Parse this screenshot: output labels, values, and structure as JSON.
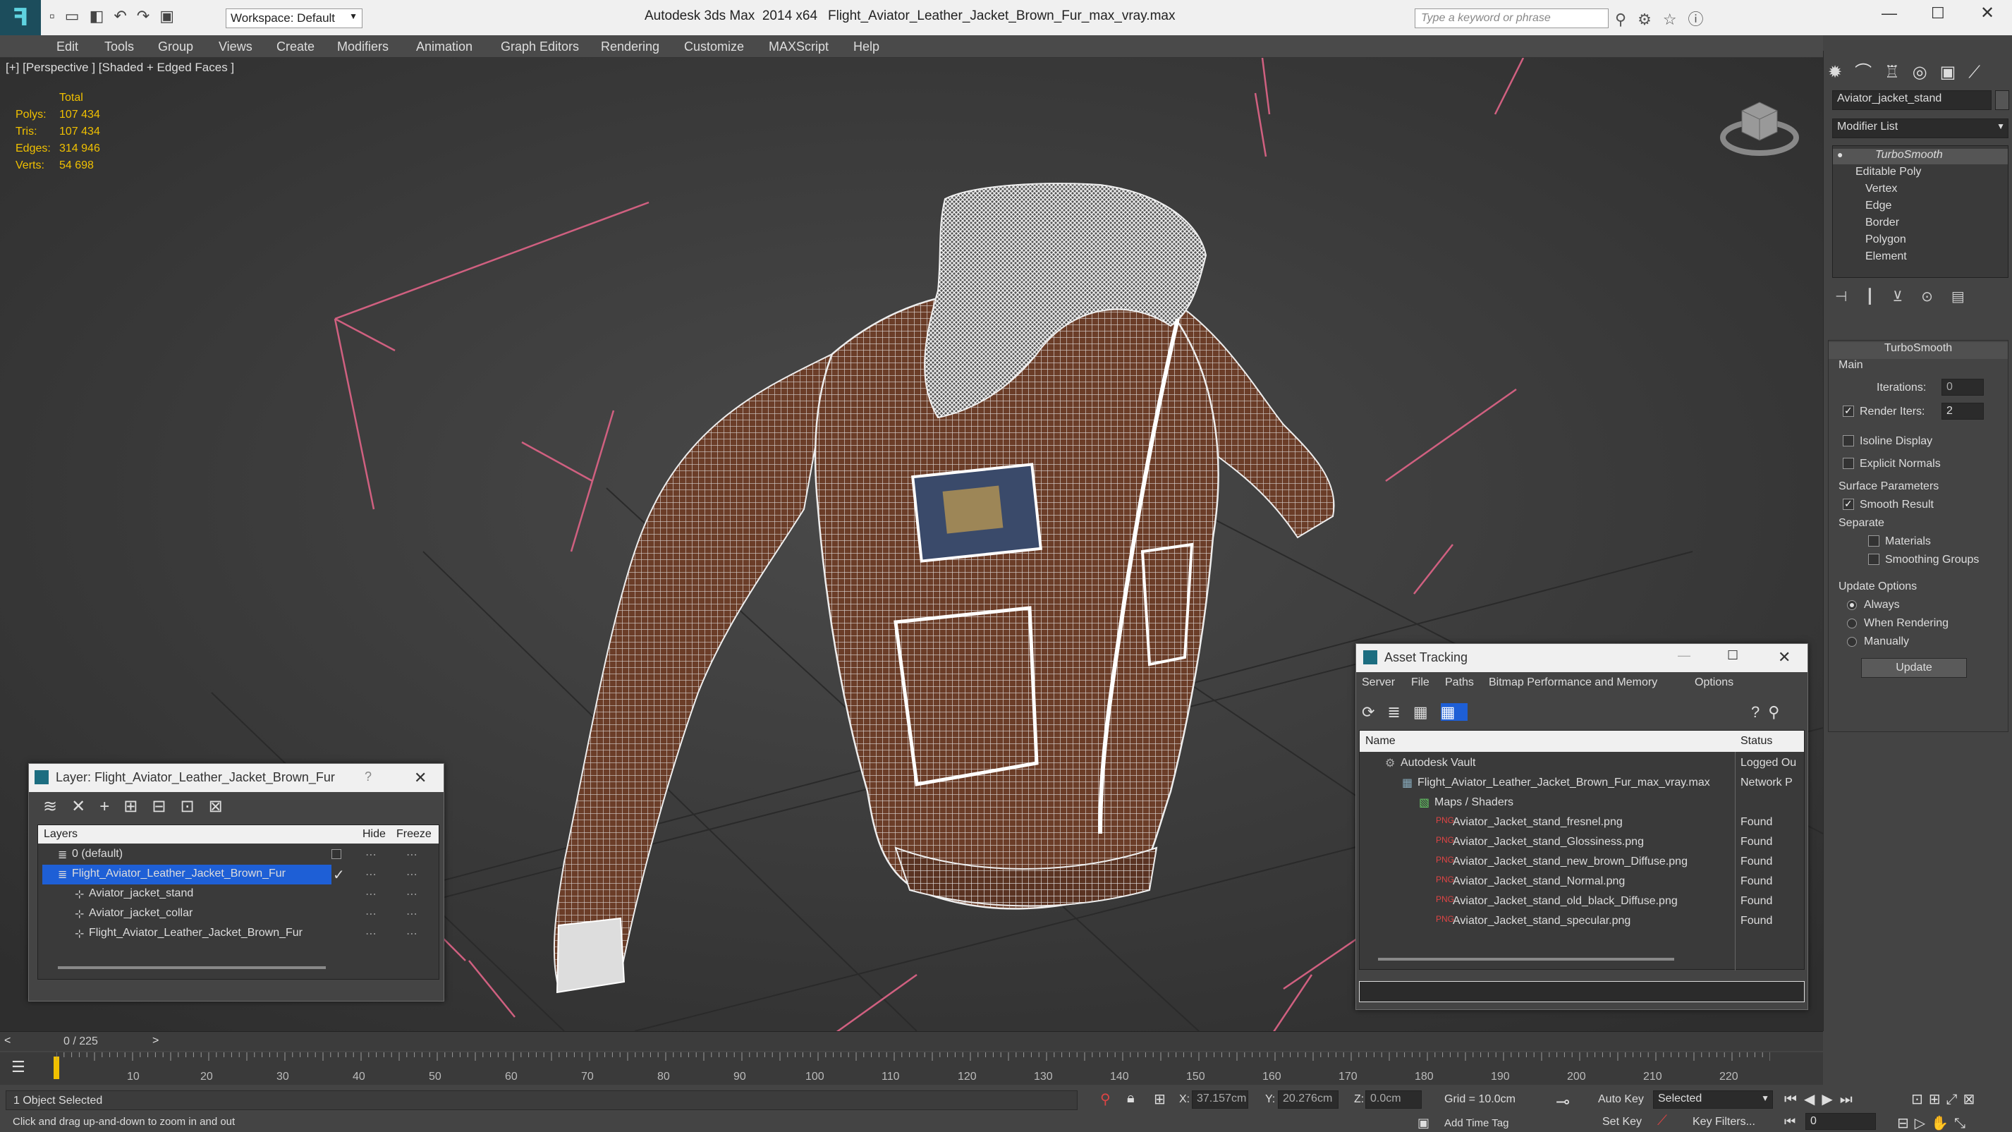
{
  "title_bar": {
    "workspace_label": "Workspace: Default",
    "app_title": "Autodesk 3ds Max  2014 x64",
    "file_title": "Flight_Aviator_Leather_Jacket_Brown_Fur_max_vray.max",
    "search_placeholder": "Type a keyword or phrase"
  },
  "menu": [
    "Edit",
    "Tools",
    "Group",
    "Views",
    "Create",
    "Modifiers",
    "Animation",
    "Graph Editors",
    "Rendering",
    "Customize",
    "MAXScript",
    "Help"
  ],
  "viewport": {
    "label": "[+] [Perspective ] [Shaded + Edged Faces ]",
    "stats_header": "Total",
    "stats": [
      {
        "label": "Polys:",
        "value": "107 434"
      },
      {
        "label": "Tris:",
        "value": "107 434"
      },
      {
        "label": "Edges:",
        "value": "314 946"
      },
      {
        "label": "Verts:",
        "value": "54 698"
      }
    ]
  },
  "command_panel": {
    "object_name": "Aviator_jacket_stand",
    "modifier_list": "Modifier List",
    "stack": [
      "TurboSmooth",
      "Editable Poly",
      "Vertex",
      "Edge",
      "Border",
      "Polygon",
      "Element"
    ],
    "rollout_title": "TurboSmooth",
    "main_group": "Main",
    "iterations_label": "Iterations:",
    "iterations_value": "0",
    "render_iters_label": "Render Iters:",
    "render_iters_value": "2",
    "isoline": "Isoline Display",
    "explicit_normals": "Explicit Normals",
    "surface_group": "Surface Parameters",
    "smooth_result": "Smooth Result",
    "separate": "Separate",
    "materials": "Materials",
    "smoothing_groups": "Smoothing Groups",
    "update_group": "Update Options",
    "always": "Always",
    "when_rendering": "When Rendering",
    "manually": "Manually",
    "update_btn": "Update"
  },
  "layer_window": {
    "title": "Layer: Flight_Aviator_Leather_Jacket_Brown_Fur",
    "col_layers": "Layers",
    "col_hide": "Hide",
    "col_freeze": "Freeze",
    "rows": [
      {
        "name": "0 (default)"
      },
      {
        "name": "Flight_Aviator_Leather_Jacket_Brown_Fur"
      },
      {
        "name": "Aviator_jacket_stand"
      },
      {
        "name": "Aviator_jacket_collar"
      },
      {
        "name": "Flight_Aviator_Leather_Jacket_Brown_Fur"
      }
    ]
  },
  "asset_window": {
    "title": "Asset Tracking",
    "menu": [
      "Server",
      "File",
      "Paths",
      "Bitmap Performance and Memory",
      "Options"
    ],
    "col_name": "Name",
    "col_status": "Status",
    "rows": [
      {
        "name": "Autodesk Vault",
        "status": "Logged Ou"
      },
      {
        "name": "Flight_Aviator_Leather_Jacket_Brown_Fur_max_vray.max",
        "status": "Network P"
      },
      {
        "name": "Maps / Shaders",
        "status": ""
      },
      {
        "name": "Aviator_Jacket_stand_fresnel.png",
        "status": "Found"
      },
      {
        "name": "Aviator_Jacket_stand_Glossiness.png",
        "status": "Found"
      },
      {
        "name": "Aviator_Jacket_stand_new_brown_Diffuse.png",
        "status": "Found"
      },
      {
        "name": "Aviator_Jacket_stand_Normal.png",
        "status": "Found"
      },
      {
        "name": "Aviator_Jacket_stand_old_black_Diffuse.png",
        "status": "Found"
      },
      {
        "name": "Aviator_Jacket_stand_specular.png",
        "status": "Found"
      }
    ]
  },
  "timeline": {
    "frame_counter": "0 / 225",
    "ticks": [
      "10",
      "20",
      "30",
      "40",
      "50",
      "60",
      "70",
      "80",
      "90",
      "100",
      "110",
      "120",
      "130",
      "140",
      "150",
      "160",
      "170",
      "180",
      "190",
      "200",
      "210",
      "220"
    ]
  },
  "status": {
    "selection": "1 Object Selected",
    "prompt": "Click and drag up-and-down to zoom in and out",
    "x_label": "X:",
    "x_value": "37.157cm",
    "y_label": "Y:",
    "y_value": "20.276cm",
    "z_label": "Z:",
    "z_value": "0.0cm",
    "grid": "Grid = 10.0cm",
    "auto_key": "Auto Key",
    "selected": "Selected",
    "set_key": "Set Key",
    "key_filters": "Key Filters...",
    "add_time_tag": "Add Time Tag",
    "frame_value": "0"
  },
  "colors": {
    "selection_blue": "#1e5fd6",
    "stats_yellow": "#f0c000",
    "frame_pink": "#d06080"
  }
}
